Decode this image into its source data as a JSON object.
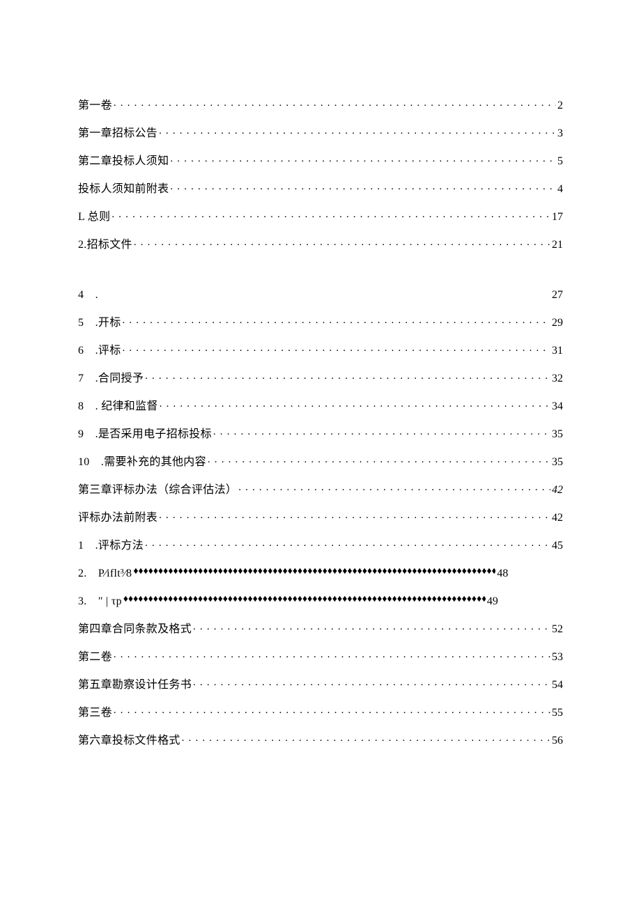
{
  "blocks": [
    {
      "items": [
        {
          "label": "第一卷",
          "page": "2",
          "leader": "dots"
        },
        {
          "label": "第一章招标公告",
          "page": "3",
          "leader": "dots"
        },
        {
          "label": "第二章投标人须知",
          "page": "5",
          "leader": "dots"
        },
        {
          "label": "投标人须知前附表",
          "page": "4",
          "leader": "dots"
        },
        {
          "label": "L 总则",
          "page": "17",
          "leader": "dots"
        },
        {
          "label": "2.招标文件",
          "page": "21",
          "leader": "dots"
        }
      ]
    },
    {
      "items": [
        {
          "label": "4 .",
          "page": "27",
          "leader": "blank"
        },
        {
          "label": "5 .开标",
          "page": "29",
          "leader": "dots"
        },
        {
          "label": "6 .评标",
          "page": "31",
          "leader": "dots"
        },
        {
          "label": "7 .合同授予",
          "page": "32",
          "leader": "dots"
        },
        {
          "label": "8 . 纪律和监督",
          "page": "34",
          "leader": "dots"
        },
        {
          "label": "9 .是否采用电子招标投标",
          "page": "35",
          "leader": "dots"
        },
        {
          "label": "10 .需要补充的其他内容",
          "page": "35",
          "leader": "dots"
        },
        {
          "label": "第三章评标办法（综合评估法）",
          "page": "42",
          "leader": "dots",
          "italicPage": true
        },
        {
          "label": "评标办法前附表",
          "page": "42",
          "leader": "dots"
        },
        {
          "label": "1 .评标方法",
          "page": "45",
          "leader": "dots"
        },
        {
          "label": "2. P⁄iflt³⁄8",
          "page": "48",
          "leader": "diamond",
          "short": true
        },
        {
          "label": "3. \" | τp",
          "page": "49",
          "leader": "diamond",
          "short": true
        },
        {
          "label": "第四章合同条款及格式",
          "page": "52",
          "leader": "dots"
        },
        {
          "label": "第二卷",
          "page": "53",
          "leader": "dots"
        },
        {
          "label": "第五章勘察设计任务书",
          "page": "54",
          "leader": "dots"
        },
        {
          "label": "第三卷",
          "page": "55",
          "leader": "dots"
        },
        {
          "label": "第六章投标文件格式",
          "page": "56",
          "leader": "dots"
        }
      ]
    }
  ]
}
